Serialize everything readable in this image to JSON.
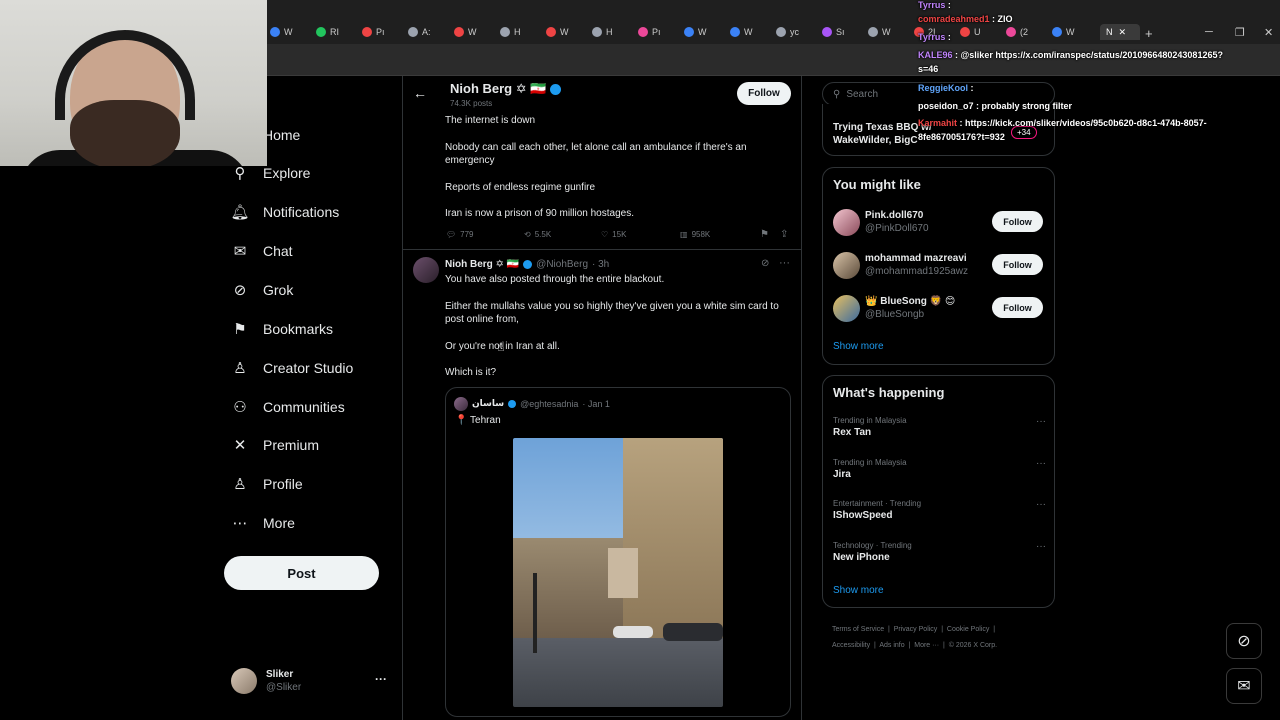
{
  "browser": {
    "tabs": [
      {
        "label": "W",
        "color": "#3b82f6"
      },
      {
        "label": "RI",
        "color": "#22c55e"
      },
      {
        "label": "Pı",
        "color": "#ef4444"
      },
      {
        "label": "A:",
        "color": "#9ca3af"
      },
      {
        "label": "W",
        "color": "#ef4444"
      },
      {
        "label": "H",
        "color": "#9ca3af"
      },
      {
        "label": "W",
        "color": "#ef4444"
      },
      {
        "label": "H",
        "color": "#9ca3af"
      },
      {
        "label": "Pı",
        "color": "#ec4899"
      },
      {
        "label": "W",
        "color": "#3b82f6"
      },
      {
        "label": "W",
        "color": "#3b82f6"
      },
      {
        "label": "yc",
        "color": "#9ca3af"
      },
      {
        "label": "Sı",
        "color": "#a855f7"
      },
      {
        "label": "W",
        "color": "#9ca3af"
      },
      {
        "label": "2I",
        "color": "#ef4444"
      },
      {
        "label": "U",
        "color": "#ef4444"
      },
      {
        "label": "(2",
        "color": "#ec4899"
      },
      {
        "label": "W",
        "color": "#3b82f6"
      }
    ],
    "active_tab": "N",
    "new_tab": "+"
  },
  "nav": {
    "items": [
      {
        "label": "Home",
        "icon": "home-icon",
        "glyph": "⌂"
      },
      {
        "label": "Explore",
        "icon": "search-icon",
        "glyph": "⚲"
      },
      {
        "label": "Notifications",
        "icon": "bell-icon",
        "glyph": "🔔︎"
      },
      {
        "label": "Chat",
        "icon": "mail-icon",
        "glyph": "✉"
      },
      {
        "label": "Grok",
        "icon": "grok-icon",
        "glyph": "⊘"
      },
      {
        "label": "Bookmarks",
        "icon": "bookmark-icon",
        "glyph": "⚑"
      },
      {
        "label": "Creator Studio",
        "icon": "creator-icon",
        "glyph": "♙"
      },
      {
        "label": "Communities",
        "icon": "communities-icon",
        "glyph": "⚇"
      },
      {
        "label": "Premium",
        "icon": "x-logo-icon",
        "glyph": "✕"
      },
      {
        "label": "Profile",
        "icon": "profile-icon",
        "glyph": "♙"
      },
      {
        "label": "More",
        "icon": "more-circle-icon",
        "glyph": "⋯"
      }
    ],
    "post_label": "Post",
    "account": {
      "name": "Sliker",
      "handle": "@Sliker",
      "menu": "···"
    }
  },
  "profile_header": {
    "name": "Nioh Berg ✡ 🇮🇷",
    "posts": "74.3K posts",
    "follow_label": "Follow"
  },
  "tweet1": {
    "lines": [
      "The internet is down",
      "Nobody can call each other, let alone call an ambulance if there's an emergency",
      "Reports of endless regime gunfire",
      "Iran is now a prison of 90 million hostages."
    ],
    "replies": "779",
    "reposts": "5.5K",
    "likes": "15K",
    "views": "958K"
  },
  "tweet2": {
    "name": "Nioh Berg ✡ 🇮🇷",
    "handle": "@NiohBerg",
    "time": "· 3h",
    "lines": [
      "You have also posted through the entire blackout.",
      "Either the mullahs value you so highly they've given you a white sim card to post online from,",
      "Or you're not in Iran at all.",
      "Which is it?"
    ],
    "quote": {
      "name": "ساسان",
      "handle": "@eghtesadnia",
      "time": "· Jan 1",
      "text": "📍 Tehran"
    }
  },
  "search": {
    "placeholder": "Search"
  },
  "live_card": {
    "title_line1": "Trying Texas BBQ w/",
    "title_line2": "WakeWilder, BigC",
    "viewers": "+34"
  },
  "you_might_like": {
    "title": "You might like",
    "users": [
      {
        "name": "Pink.doll670",
        "handle": "@PinkDoll670",
        "follow": "Follow"
      },
      {
        "name": "mohammad mazreavi",
        "handle": "@mohammad1925awz",
        "follow": "Follow"
      },
      {
        "name": "👑 BlueSong 🦁 😊",
        "handle": "@BlueSongb",
        "follow": "Follow"
      }
    ],
    "show_more": "Show more"
  },
  "whats_happening": {
    "title": "What's happening",
    "trends": [
      {
        "context": "Trending in Malaysia",
        "title": "Rex Tan"
      },
      {
        "context": "Trending in Malaysia",
        "title": "Jira"
      },
      {
        "context": "Entertainment · Trending",
        "title": "IShowSpeed"
      },
      {
        "context": "Technology · Trending",
        "title": "New iPhone"
      }
    ],
    "show_more": "Show more"
  },
  "footer": {
    "links": [
      "Terms of Service",
      "Privacy Policy",
      "Cookie Policy",
      "Accessibility",
      "Ads info",
      "More ···",
      "© 2026 X Corp."
    ]
  },
  "chat": [
    {
      "user": "Tyrrus",
      "msg": ":",
      "color": "#c084fc"
    },
    {
      "user": "comradeahmed1",
      "msg": ": ZIO",
      "color": "#ef4444"
    },
    {
      "user": "Tyrrus",
      "msg": ":",
      "color": "#c084fc"
    },
    {
      "user": "KALE96",
      "msg": ": @sliker https://x.com/iranspec/status/2010966480243081265?",
      "color": "#c084fc"
    },
    {
      "user": "",
      "msg": "s=46",
      "color": "#ffffff"
    },
    {
      "user": "ReggieKool",
      "msg": ":",
      "color": "#60a5fa"
    },
    {
      "user": "poseidon_o7",
      "msg": ": probably strong filter",
      "color": "#ffffff"
    },
    {
      "user": "Karmahit",
      "msg": ": https://kick.com/sliker/videos/95c0b620-d8c1-474b-8057-",
      "color": "#ef4444"
    },
    {
      "user": "",
      "msg": "8fe867005176?t=932",
      "color": "#ffffff"
    }
  ],
  "colors": {
    "bg": "#000000",
    "border": "#2f3336",
    "muted": "#71767b",
    "verified": "#1d9bf0",
    "follow_btn": "#eff3f4"
  }
}
